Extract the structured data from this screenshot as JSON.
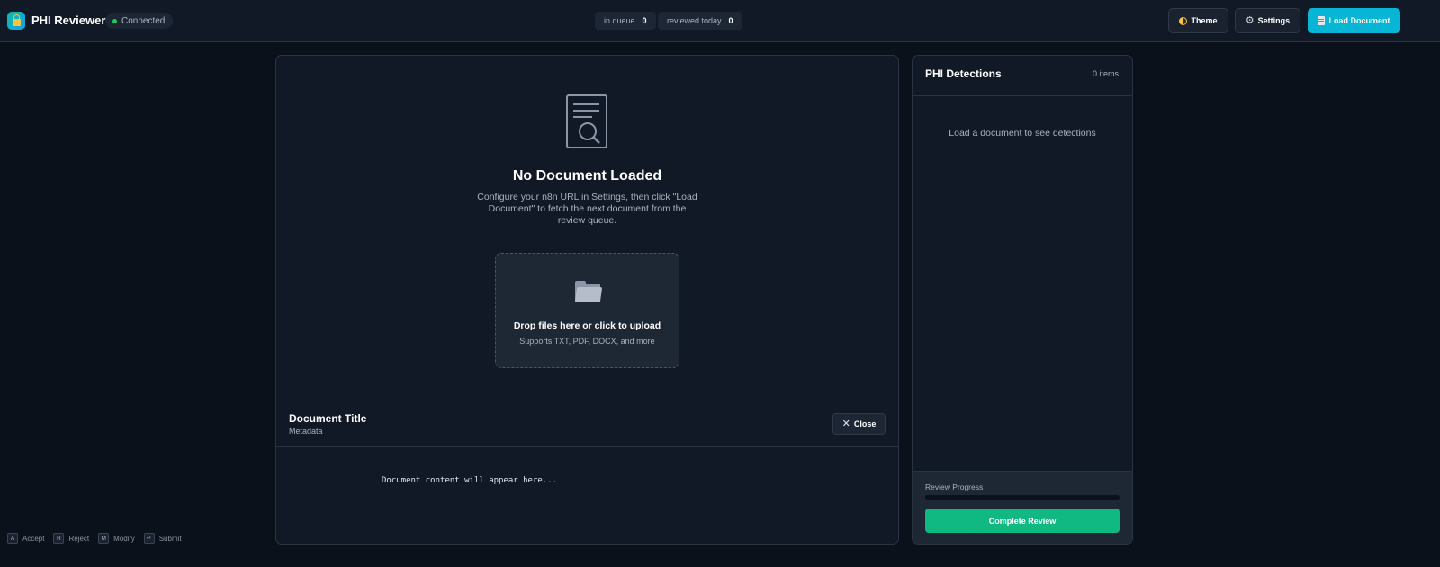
{
  "header": {
    "app_title": "PHI Reviewer",
    "status": "Connected",
    "stats": [
      {
        "label": "in queue",
        "value": "0"
      },
      {
        "label": "reviewed today",
        "value": "0"
      }
    ],
    "buttons": {
      "theme": "Theme",
      "settings": "Settings",
      "load_document": "Load Document"
    }
  },
  "document": {
    "empty_title": "No Document Loaded",
    "empty_description": "Configure your n8n URL in Settings, then click \"Load Document\" to fetch the next document from the review queue.",
    "dropzone": {
      "title": "Drop files here or click to upload",
      "subtitle": "Supports TXT, PDF, DOCX, and more"
    },
    "title": "Document Title",
    "metadata": "Metadata",
    "close_label": "Close",
    "content_placeholder": "Document content will appear here..."
  },
  "detections": {
    "title": "PHI Detections",
    "count": "0 items",
    "empty": "Load a document to see detections",
    "progress_label": "Review Progress",
    "progress_fraction": 0,
    "complete_label": "Complete Review"
  },
  "shortcuts": [
    {
      "key": "A",
      "label": "Accept"
    },
    {
      "key": "R",
      "label": "Reject"
    },
    {
      "key": "M",
      "label": "Modify"
    },
    {
      "key": "↵",
      "label": "Submit"
    }
  ],
  "colors": {
    "accent": "#06b6d4",
    "success": "#10b981",
    "status_online": "#22c55e"
  }
}
